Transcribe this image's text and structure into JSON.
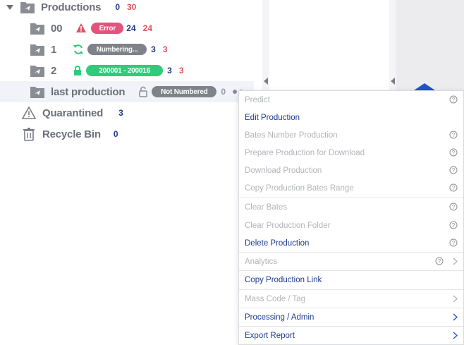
{
  "tree": {
    "root": {
      "label": "Productions",
      "count_blue": "0",
      "count_red": "30"
    },
    "items": [
      {
        "label": "00",
        "badge": "Error",
        "count_blue": "24",
        "count_red": "24"
      },
      {
        "label": "1",
        "badge": "Numbering...",
        "count_blue": "3",
        "count_red": "3"
      },
      {
        "label": "2",
        "badge": "200001 - 200016",
        "count_blue": "3",
        "count_red": "3"
      },
      {
        "label": "last production",
        "badge": "Not Numbered",
        "count_gray": "0"
      }
    ],
    "quarantined": {
      "label": "Quarantined",
      "count_blue": "3"
    },
    "recycle": {
      "label": "Recycle Bin",
      "count_blue": "0"
    }
  },
  "menu": {
    "items": [
      {
        "label": "Predict"
      },
      {
        "label": "Edit Production"
      },
      {
        "label": "Bates Number Production"
      },
      {
        "label": "Prepare Production for Download"
      },
      {
        "label": "Download Production"
      },
      {
        "label": "Copy Production Bates Range"
      },
      {
        "label": "Clear Bates"
      },
      {
        "label": "Clear Production Folder"
      },
      {
        "label": "Delete Production"
      },
      {
        "label": "Analytics"
      },
      {
        "label": "Copy Production Link"
      },
      {
        "label": "Mass Code / Tag"
      },
      {
        "label": "Processing / Admin"
      },
      {
        "label": "Export Report"
      }
    ]
  },
  "colors": {
    "accent_blue": "#1f3c88",
    "count_red": "#e0525f",
    "error_pink": "#e2547d",
    "success_green": "#2ecc7a",
    "refresh_green": "#2ecc71"
  }
}
